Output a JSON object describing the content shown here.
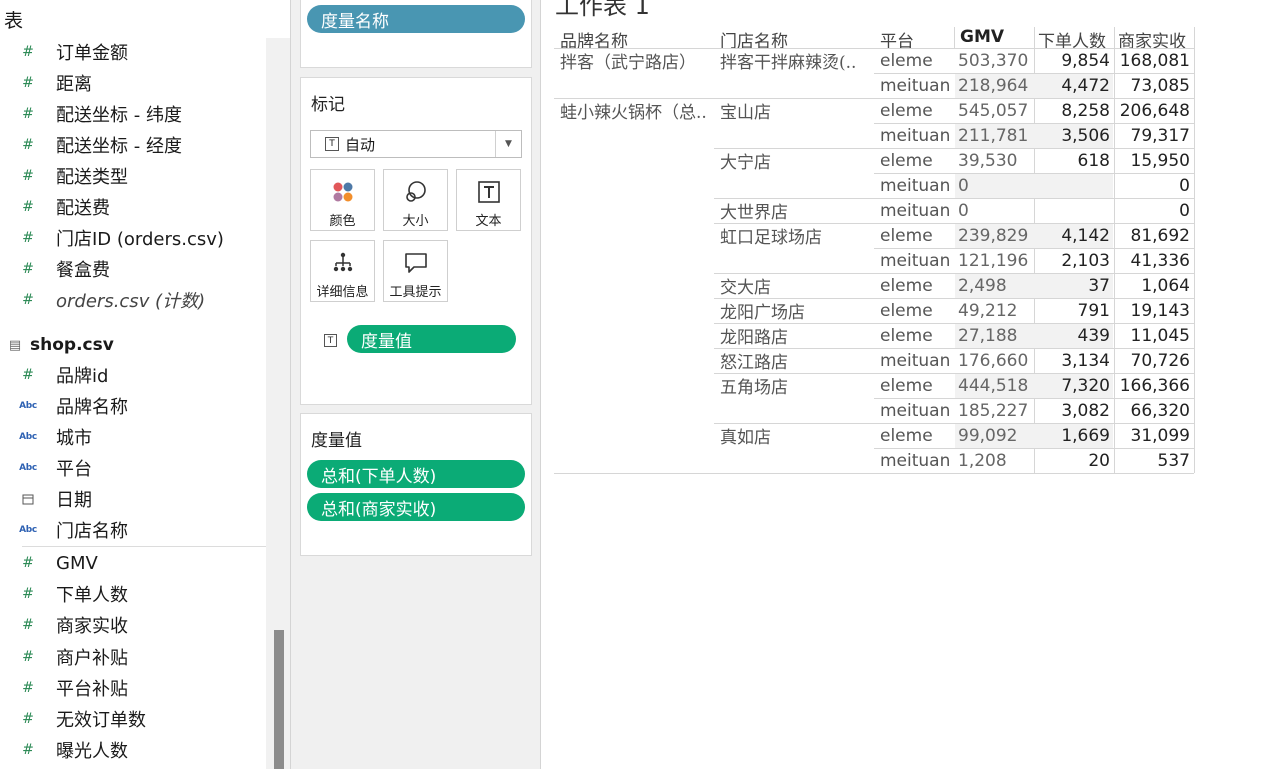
{
  "data_pane": {
    "header": "表",
    "orders_fields": [
      {
        "type": "measure",
        "label": "订单金额"
      },
      {
        "type": "measure",
        "label": "距离"
      },
      {
        "type": "measure",
        "label": "配送坐标 - 纬度"
      },
      {
        "type": "measure",
        "label": "配送坐标 - 经度"
      },
      {
        "type": "measure",
        "label": "配送类型"
      },
      {
        "type": "measure",
        "label": "配送费"
      },
      {
        "type": "measure",
        "label": "门店ID (orders.csv)"
      },
      {
        "type": "measure",
        "label": "餐盒费"
      },
      {
        "type": "measure",
        "label": "orders.csv (计数)",
        "italic": true
      }
    ],
    "datasource": "shop.csv",
    "shop_fields": [
      {
        "type": "measure",
        "label": "品牌id"
      },
      {
        "type": "dimension",
        "label": "品牌名称"
      },
      {
        "type": "dimension",
        "label": "城市"
      },
      {
        "type": "dimension",
        "label": "平台"
      },
      {
        "type": "date",
        "label": "日期"
      },
      {
        "type": "dimension",
        "label": "门店名称"
      },
      {
        "type": "measure",
        "label": "GMV"
      },
      {
        "type": "measure",
        "label": "下单人数"
      },
      {
        "type": "measure",
        "label": "商家实收"
      },
      {
        "type": "measure",
        "label": "商户补贴"
      },
      {
        "type": "measure",
        "label": "平台补贴"
      },
      {
        "type": "measure",
        "label": "无效订单数"
      },
      {
        "type": "measure",
        "label": "曝光人数"
      }
    ]
  },
  "shelves": {
    "top_pill": "度量名称",
    "marks": {
      "title": "标记",
      "mark_type": "自动",
      "buttons": {
        "color": "颜色",
        "size": "大小",
        "text": "文本",
        "detail": "详细信息",
        "tooltip": "工具提示"
      },
      "text_pill": "度量值"
    },
    "measure_values": {
      "title": "度量值",
      "pills": [
        "总和(下单人数)",
        "总和(商家实收)"
      ]
    }
  },
  "view": {
    "sheet_title": "工作表 1",
    "headers": {
      "brand": "品牌名称",
      "store": "门店名称",
      "platform": "平台",
      "gmv": "GMV",
      "orders": "下单人数",
      "revenue": "商家实收"
    },
    "brands": [
      "拌客（武宁路店）",
      "蛙小辣火锅杯（总.."
    ],
    "rows": [
      {
        "store": "拌客干拌麻辣烫(..",
        "platform": "eleme",
        "gmv": "503,370",
        "orders": "9,854",
        "revenue": "168,081"
      },
      {
        "store": "",
        "platform": "meituan",
        "gmv": "218,964",
        "orders": "4,472",
        "revenue": "73,085"
      },
      {
        "store": "宝山店",
        "platform": "eleme",
        "gmv": "545,057",
        "orders": "8,258",
        "revenue": "206,648"
      },
      {
        "store": "",
        "platform": "meituan",
        "gmv": "211,781",
        "orders": "3,506",
        "revenue": "79,317"
      },
      {
        "store": "大宁店",
        "platform": "eleme",
        "gmv": "39,530",
        "orders": "618",
        "revenue": "15,950"
      },
      {
        "store": "",
        "platform": "meituan",
        "gmv": "0",
        "orders": "",
        "revenue": "0"
      },
      {
        "store": "大世界店",
        "platform": "meituan",
        "gmv": "0",
        "orders": "",
        "revenue": "0"
      },
      {
        "store": "虹口足球场店",
        "platform": "eleme",
        "gmv": "239,829",
        "orders": "4,142",
        "revenue": "81,692"
      },
      {
        "store": "",
        "platform": "meituan",
        "gmv": "121,196",
        "orders": "2,103",
        "revenue": "41,336"
      },
      {
        "store": "交大店",
        "platform": "eleme",
        "gmv": "2,498",
        "orders": "37",
        "revenue": "1,064"
      },
      {
        "store": "龙阳广场店",
        "platform": "eleme",
        "gmv": "49,212",
        "orders": "791",
        "revenue": "19,143"
      },
      {
        "store": "龙阳路店",
        "platform": "eleme",
        "gmv": "27,188",
        "orders": "439",
        "revenue": "11,045"
      },
      {
        "store": "怒江路店",
        "platform": "meituan",
        "gmv": "176,660",
        "orders": "3,134",
        "revenue": "70,726"
      },
      {
        "store": "五角场店",
        "platform": "eleme",
        "gmv": "444,518",
        "orders": "7,320",
        "revenue": "166,366"
      },
      {
        "store": "",
        "platform": "meituan",
        "gmv": "185,227",
        "orders": "3,082",
        "revenue": "66,320"
      },
      {
        "store": "真如店",
        "platform": "eleme",
        "gmv": "99,092",
        "orders": "1,669",
        "revenue": "31,099"
      },
      {
        "store": "",
        "platform": "meituan",
        "gmv": "1,208",
        "orders": "20",
        "revenue": "537"
      }
    ]
  }
}
